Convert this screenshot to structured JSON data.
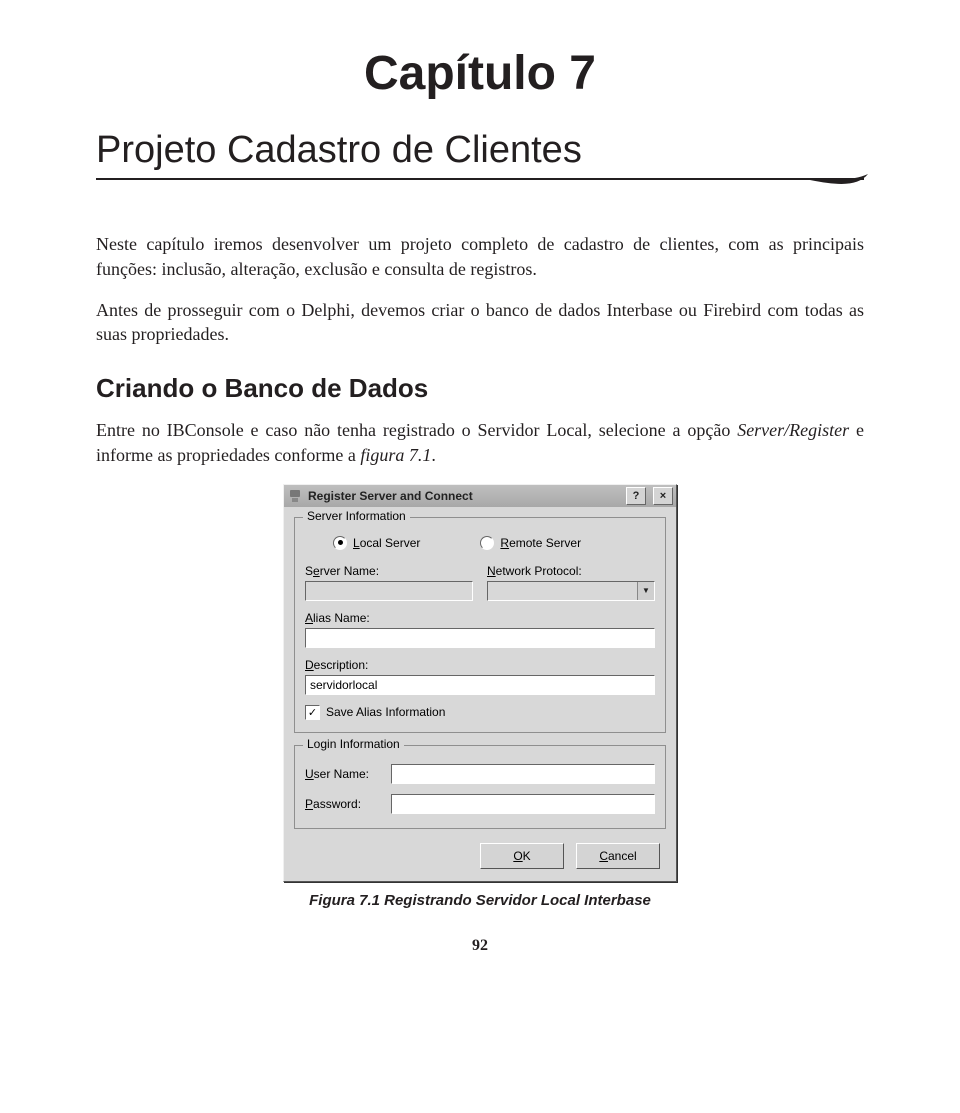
{
  "chapter_title": "Capítulo 7",
  "section_title": "Projeto Cadastro de Clientes",
  "paragraphs": {
    "p1": "Neste capítulo iremos desenvolver um projeto completo de cadastro de clientes, com as principais funções: inclusão, alteração, exclusão e consulta de registros.",
    "p2": "Antes de prosseguir com o Delphi, devemos criar o banco de dados Interbase ou Firebird com todas as suas propriedades."
  },
  "subheading": "Criando o Banco de Dados",
  "paragraph3_parts": {
    "a": "Entre no IBConsole e caso não tenha registrado o Servidor Local, selecione a opção ",
    "b": "Server/Register",
    "c": " e informe as propriedades conforme a ",
    "d": "figura 7.1",
    "e": "."
  },
  "dialog": {
    "title": "Register Server and Connect",
    "help_label": "?",
    "close_label": "×",
    "server_info_legend": "Server Information",
    "radio_local": "Local Server",
    "radio_remote": "Remote Server",
    "server_name_label": "Server Name:",
    "server_name_underline": "e",
    "network_protocol_label": "Network Protocol:",
    "network_protocol_underline": "N",
    "server_name_value": "",
    "network_protocol_value": "",
    "alias_name_label": "Alias Name:",
    "alias_name_underline": "A",
    "alias_name_value": "",
    "description_label": "Description:",
    "description_underline": "D",
    "description_value": "servidorlocal",
    "save_alias_label": "Save Alias Information",
    "save_alias_checked": "✓",
    "login_info_legend": "Login Information",
    "user_name_label": "User Name:",
    "user_name_underline": "U",
    "user_name_value": "",
    "password_label": "Password:",
    "password_underline": "P",
    "password_value": "",
    "ok_label": "OK",
    "ok_underline": "O",
    "cancel_label": "Cancel",
    "cancel_underline": "C"
  },
  "figure_caption": "Figura 7.1 Registrando Servidor Local Interbase",
  "page_number": "92"
}
